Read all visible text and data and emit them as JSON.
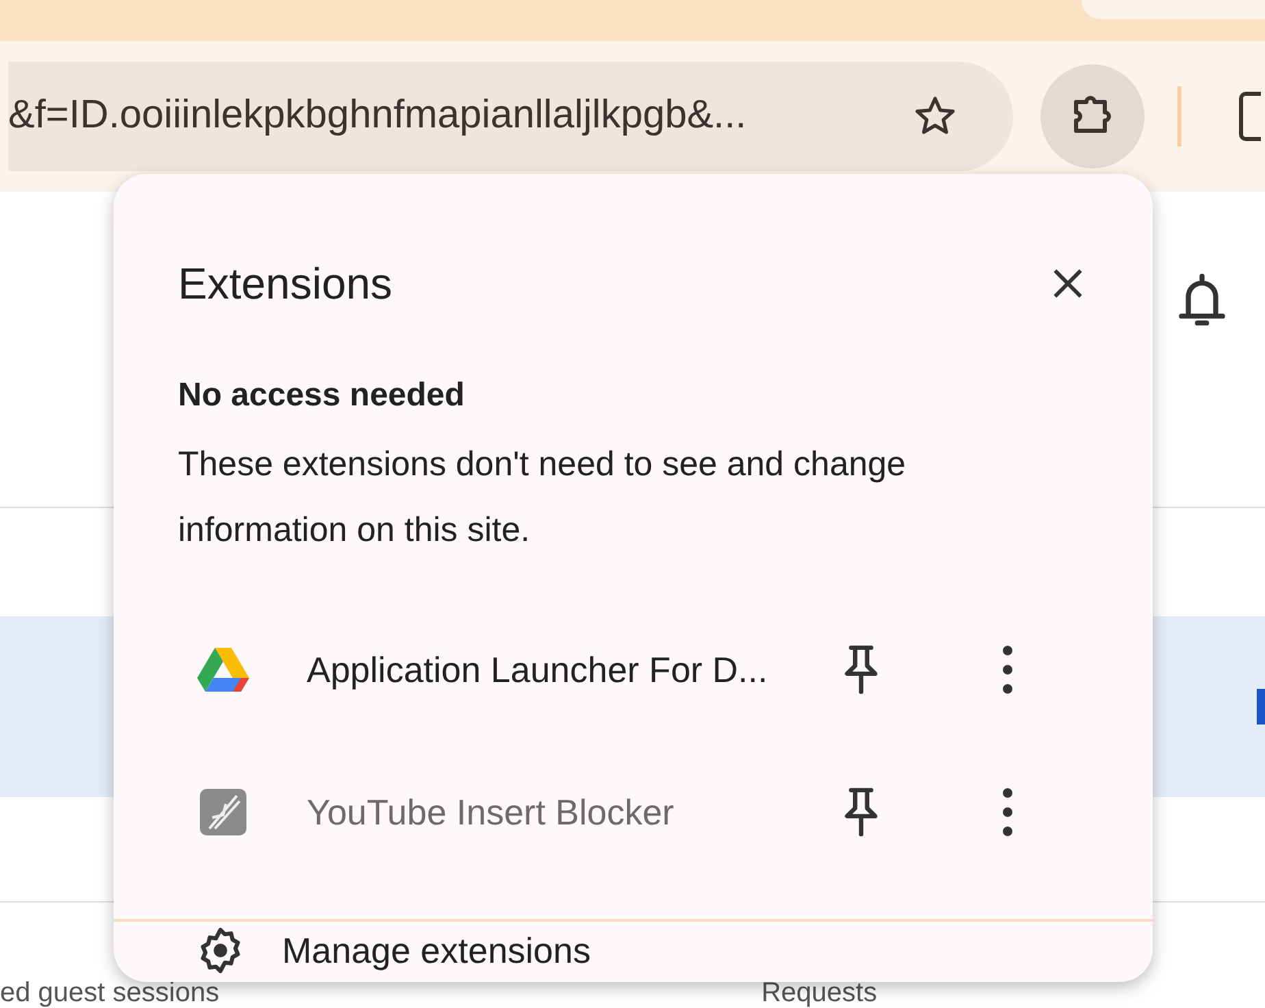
{
  "address_bar": {
    "url": "&f=ID.ooiiinlekpkbghnfmapianllaljlkpgb&..."
  },
  "extensions_popup": {
    "title": "Extensions",
    "section": {
      "heading": "No access needed",
      "description": "These extensions don't need to see and change information on this site."
    },
    "extensions": [
      {
        "name": "Application Launcher For D...",
        "disabled": false
      },
      {
        "name": "YouTube Insert Blocker",
        "disabled": true
      }
    ],
    "manage_label": "Manage extensions"
  },
  "page": {
    "texts": [
      "ed guest sessions",
      "Requests"
    ]
  }
}
